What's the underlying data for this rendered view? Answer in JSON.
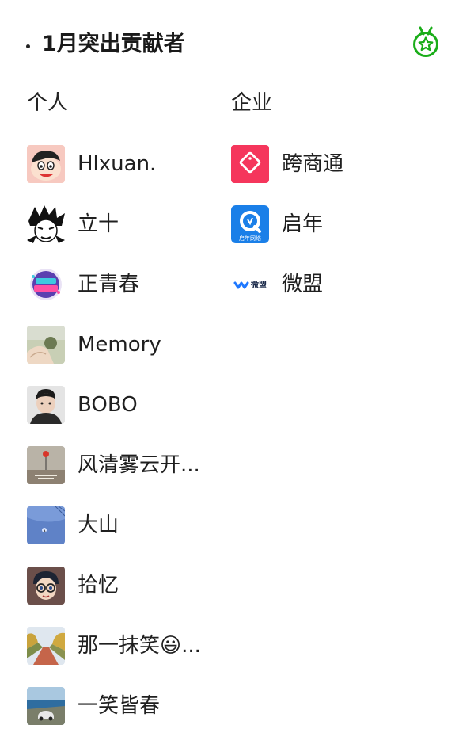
{
  "header": {
    "title": "1月突出贡献者",
    "medal_icon": "medal-star-icon",
    "medal_color": "#1aad19"
  },
  "columns": {
    "personal_label": "个人",
    "company_label": "企业"
  },
  "personal": [
    {
      "name": "Hlxuan.",
      "avatar": "cartoon-boy-avatar"
    },
    {
      "name": "立十",
      "avatar": "manga-portrait-avatar"
    },
    {
      "name": "正青春",
      "avatar": "badge-logo-avatar"
    },
    {
      "name": "Memory",
      "avatar": "hand-photo-avatar"
    },
    {
      "name": "BOBO",
      "avatar": "person-photo-avatar"
    },
    {
      "name": "风清雾云开...",
      "avatar": "poster-avatar"
    },
    {
      "name": "大山",
      "avatar": "blue-sky-avatar"
    },
    {
      "name": "拾忆",
      "avatar": "anime-detective-avatar"
    },
    {
      "name": "那一抹笑😃...",
      "avatar": "autumn-road-avatar"
    },
    {
      "name": "一笑皆春",
      "avatar": "seaside-car-avatar"
    }
  ],
  "companies": [
    {
      "name": "跨商通",
      "avatar": "kuashangtong-logo",
      "color": "#f5365c"
    },
    {
      "name": "启年",
      "avatar": "qinian-logo",
      "color": "#1a7fe8",
      "logo_text": "启年网络"
    },
    {
      "name": "微盟",
      "avatar": "weimob-logo",
      "color": "#1e78ff",
      "logo_text": "微盟"
    }
  ]
}
